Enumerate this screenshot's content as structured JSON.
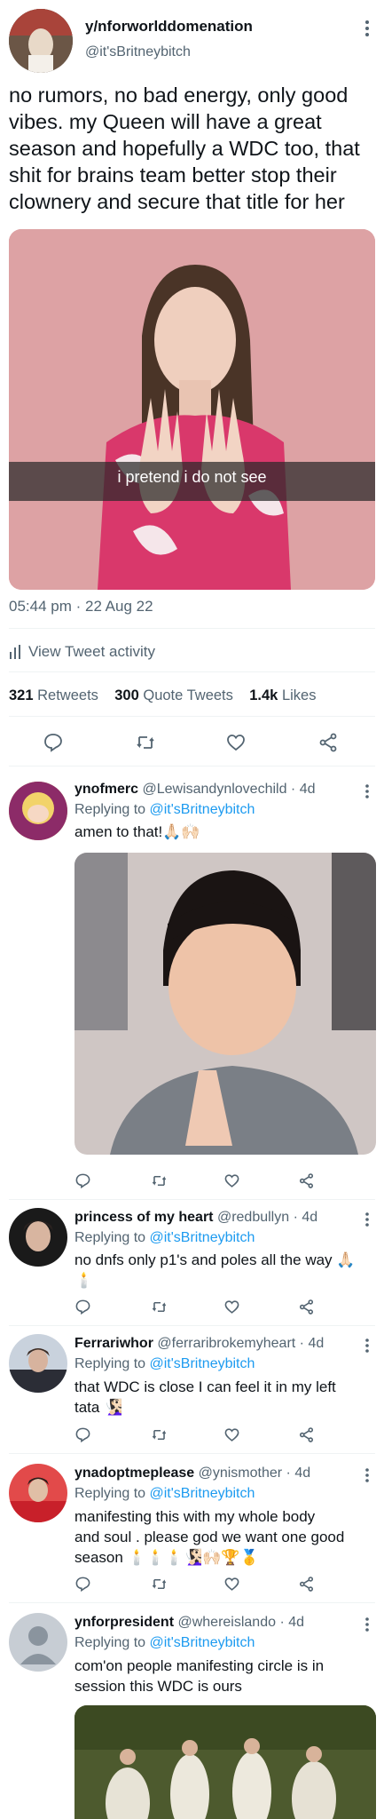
{
  "tweet": {
    "name": "y/nforworlddomenation",
    "handle": "@it'sBritneybitch",
    "text": "no rumors, no bad energy, only good vibes. my Queen will have a great season and hopefully a WDC too, that shit for brains team better stop their clownery and secure that title for her",
    "media_caption": "i pretend i do not see",
    "time": "05:44 pm · 22 Aug 22",
    "activity": "View Tweet activity",
    "retweets_count": "321",
    "retweets_label": "Retweets",
    "quotes_count": "300",
    "quotes_label": "Quote Tweets",
    "likes_count": "1.4k",
    "likes_label": "Likes"
  },
  "replies": [
    {
      "name": "ynofmerc",
      "handle": "@Lewisandynlovechild · 4d",
      "replying_prefix": "Replying to",
      "replying_to": "@it'sBritneybitch",
      "text": "amen to that!🙏🏻🙌🏻"
    },
    {
      "name": "princess of my heart",
      "handle": "@redbullyn · 4d",
      "replying_prefix": "Replying to",
      "replying_to": "@it'sBritneybitch",
      "text_line1": "no dnfs only p1's and poles all the way 🙏🏻",
      "text_line2": "🕯️"
    },
    {
      "name": "Ferrariwhor",
      "handle": "@ferraribrokemyheart · 4d",
      "replying_prefix": "Replying to",
      "replying_to": "@it'sBritneybitch",
      "text_line1": "that WDC is close I can feel it in my left",
      "text_line2": "tata 🧏🏻‍♀️"
    },
    {
      "name": "ynadoptmeplease",
      "handle": "@ynismother · 4d",
      "replying_prefix": "Replying to",
      "replying_to": "@it'sBritneybitch",
      "text_line1": "manifesting this with my whole body",
      "text_line2": "and soul . please god we want one good",
      "text_line3": "season 🕯️🕯️🕯️🧏🏻‍♀️🙌🏻🏆🥇"
    },
    {
      "name": "ynforpresident",
      "handle": "@whereislando · 4d",
      "replying_prefix": "Replying to",
      "replying_to": "@it'sBritneybitch",
      "text_line1": "com'on people manifesting circle is in",
      "text_line2": "session this WDC is ours"
    }
  ],
  "colors": {
    "link": "#1d9bf0",
    "muted": "#536471",
    "divider": "#eff3f4"
  }
}
